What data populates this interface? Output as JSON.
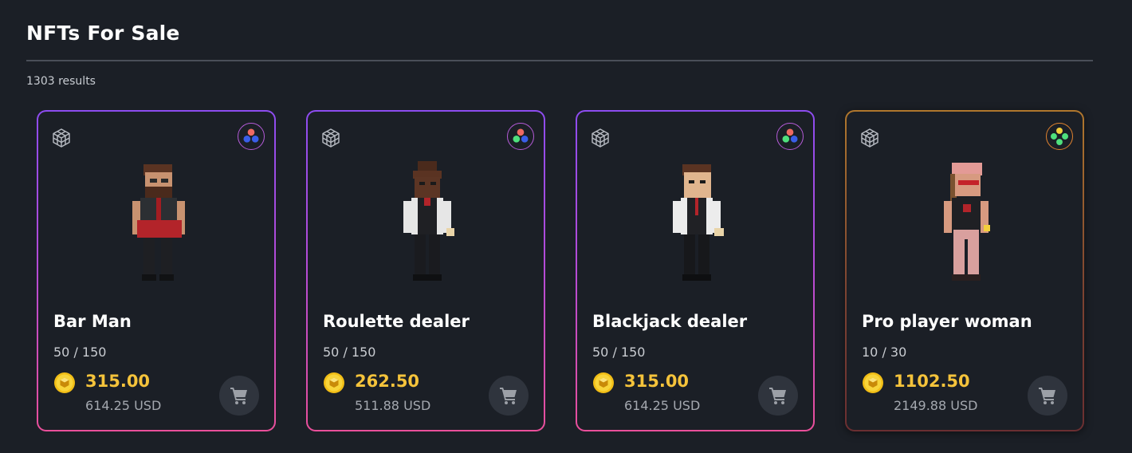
{
  "page": {
    "title": "NFTs For Sale",
    "results": "1303 results"
  },
  "cards": [
    {
      "name": "Bar Man",
      "supply": "50 / 150",
      "price": "315.00",
      "usd": "614.25 USD",
      "border": "purple-pink",
      "rarity_dots": [
        "#ef6a63",
        "#3a5ee8",
        "#3a5ee8"
      ],
      "avatar": "bartender-avatar"
    },
    {
      "name": "Roulette dealer",
      "supply": "50 / 150",
      "price": "262.50",
      "usd": "511.88 USD",
      "border": "purple-pink",
      "rarity_dots": [
        "#ef6a63",
        "#4fe07d",
        "#3a5ee8"
      ],
      "avatar": "roulette-dealer-avatar"
    },
    {
      "name": "Blackjack dealer",
      "supply": "50 / 150",
      "price": "315.00",
      "usd": "614.25 USD",
      "border": "purple-pink",
      "rarity_dots": [
        "#ef6a63",
        "#4fe07d",
        "#3a5ee8"
      ],
      "avatar": "blackjack-dealer-avatar"
    },
    {
      "name": "Pro player woman",
      "supply": "10 / 30",
      "price": "1102.50",
      "usd": "2149.88 USD",
      "border": "gold-red",
      "rarity_dots": [
        "#f3cf3c",
        "#4fe07d",
        "#4fe07d",
        "#4fe07d"
      ],
      "avatar": "pro-player-woman-avatar"
    }
  ],
  "icons": {
    "model": "cube-wireframe-icon",
    "rarity": "rarity-dots-icon",
    "currency": "gold-coin-icon",
    "cart": "shopping-cart-icon"
  },
  "colors": {
    "background": "#1b1f26",
    "price": "#f5c33b",
    "cart_button": "#2f343d",
    "border_purple": "#8d4cf0",
    "border_pink": "#ea4f9a",
    "border_gold": "#b0772d"
  }
}
